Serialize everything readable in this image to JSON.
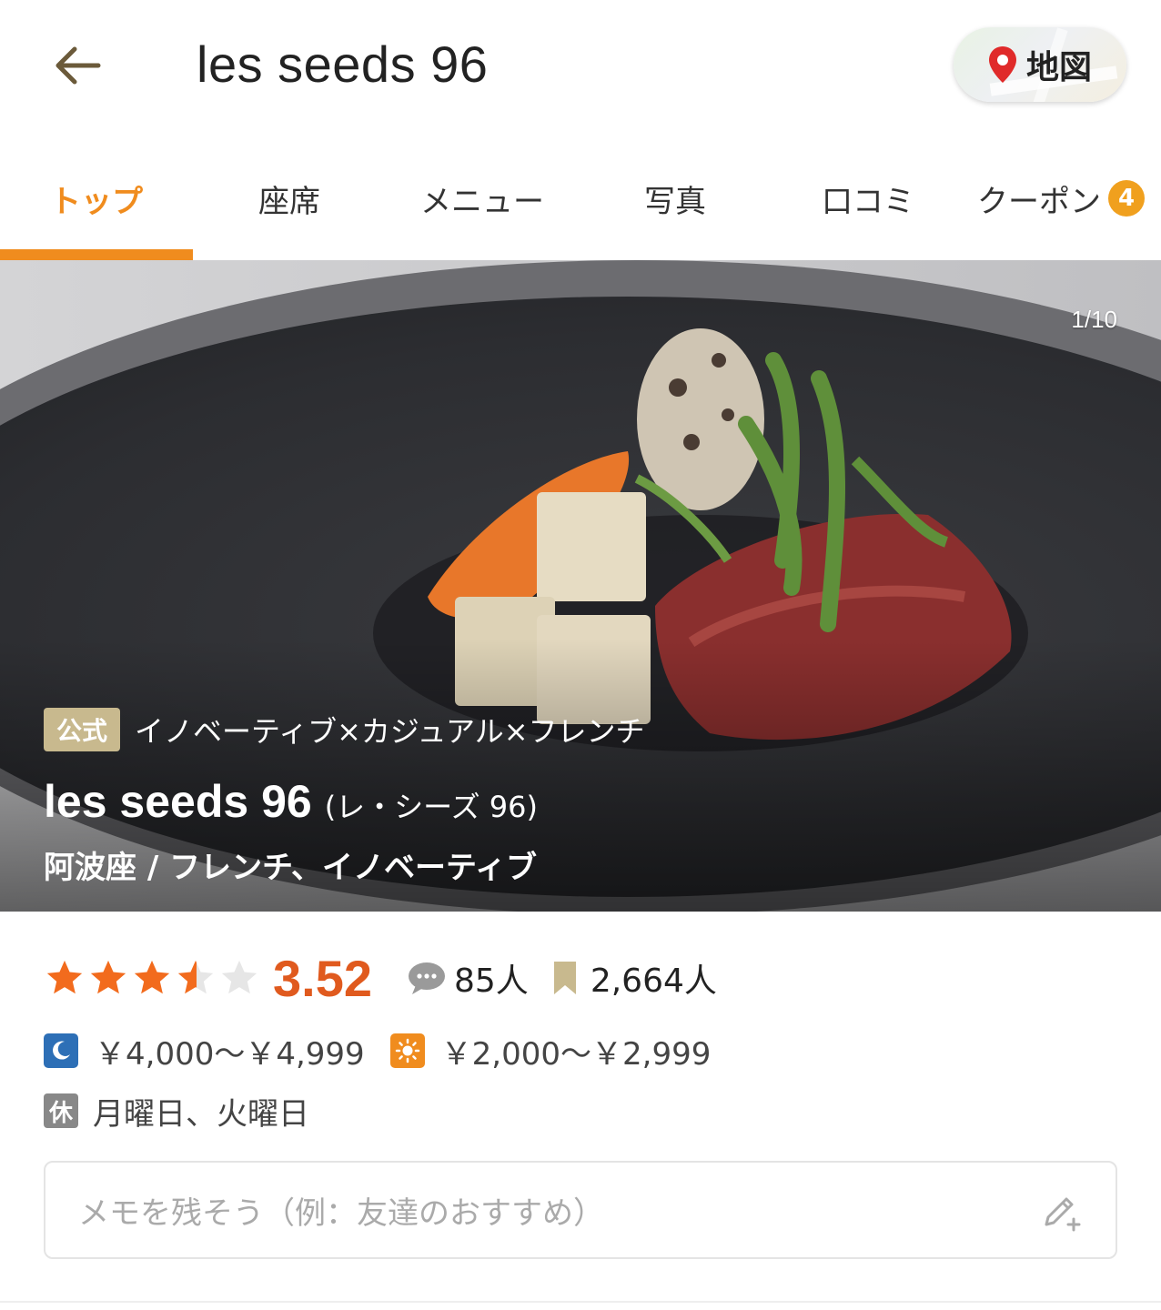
{
  "header": {
    "title": "les seeds 96",
    "map_label": "地図",
    "back_icon": "arrow-left-icon"
  },
  "tabs": [
    {
      "label": "トップ",
      "active": true
    },
    {
      "label": "座席",
      "active": false
    },
    {
      "label": "メニュー",
      "active": false
    },
    {
      "label": "写真",
      "active": false
    },
    {
      "label": "口コミ",
      "active": false
    },
    {
      "label": "クーポン",
      "active": false,
      "badge": "4"
    }
  ],
  "hero": {
    "counter": "1/10",
    "official_badge": "公式",
    "catchcopy": "イノベーティブ×カジュアル×フレンチ",
    "name": "les seeds 96",
    "name_kana": "(レ・シーズ 96)",
    "area_genre": "阿波座 / フレンチ、イノベーティブ"
  },
  "rating": {
    "score": "3.52",
    "stars_value": 3.52,
    "stars_max": 5,
    "reviews": "85人",
    "saves": "2,664人"
  },
  "price": {
    "dinner": "￥4,000～￥4,999",
    "lunch": "￥2,000～￥2,999"
  },
  "holiday": {
    "icon_label": "休",
    "days": "月曜日、火曜日"
  },
  "memo": {
    "placeholder": "メモを残そう（例：友達のおすすめ）"
  },
  "colors": {
    "accent": "#f08c1e",
    "score": "#e05a1e",
    "night_icon": "#2d6fb6",
    "official_badge": "#c8b98e"
  }
}
